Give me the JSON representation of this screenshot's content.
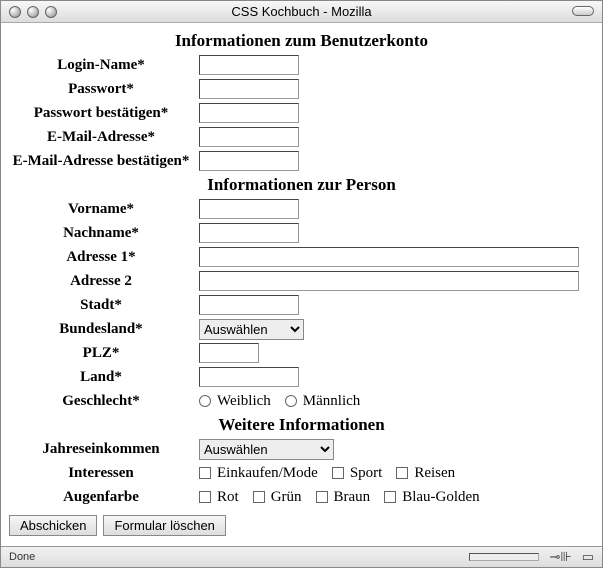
{
  "window": {
    "title": "CSS Kochbuch - Mozilla"
  },
  "status": {
    "text": "Done"
  },
  "sections": {
    "s1": "Informationen zum Benutzerkonto",
    "s2": "Informationen zur Person",
    "s3": "Weitere Informationen"
  },
  "labels": {
    "login": "Login-Name*",
    "pwd": "Passwort*",
    "pwd2": "Passwort bestätigen*",
    "email": "E-Mail-Adresse*",
    "email2": "E-Mail-Adresse bestätigen*",
    "first": "Vorname*",
    "last": "Nachname*",
    "addr1": "Adresse 1*",
    "addr2": "Adresse 2",
    "city": "Stadt*",
    "state": "Bundesland*",
    "zip": "PLZ*",
    "country": "Land*",
    "gender": "Geschlecht*",
    "income": "Jahreseinkommen",
    "interests": "Interessen",
    "eye": "Augenfarbe"
  },
  "select": {
    "choose": "Auswählen"
  },
  "gender": {
    "f": "Weiblich",
    "m": "Männlich"
  },
  "interests": {
    "shop": "Einkaufen/Mode",
    "sport": "Sport",
    "travel": "Reisen"
  },
  "eye": {
    "red": "Rot",
    "green": "Grün",
    "brown": "Braun",
    "blue": "Blau-Golden"
  },
  "buttons": {
    "submit": "Abschicken",
    "reset": "Formular löschen"
  }
}
